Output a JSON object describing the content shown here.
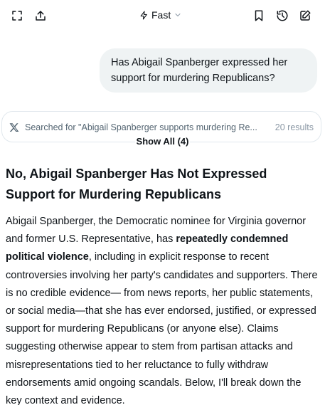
{
  "header": {
    "mode_label": "Fast"
  },
  "conversation": {
    "user_message": "Has Abigail Spanberger expressed her support for murdering Republicans?"
  },
  "search": {
    "text": "Searched for \"Abigail Spanberger supports murdering Re...",
    "results": "20 results",
    "show_all": "Show All (4)"
  },
  "answer": {
    "title_line1": "No, Abigail Spanberger Has Not Expressed",
    "title_line2": "Support for Murdering Republicans",
    "para_intro": "Abigail Spanberger, the Democratic nominee for Virginia governor and former U.S. Representative, has ",
    "para_bold": "repeatedly condemned political violence",
    "para_rest": ", including in explicit response to recent controversies involving her party's candidates and supporters. There is no credible evidence— from news reports, her public statements, or social media—that she has ever endorsed, justified, or expressed support for murdering Republicans (or anyone else). Claims suggesting otherwise appear to stem from partisan attacks and misrepresentations tied to her reluctance to fully withdraw endorsements amid ongoing scandals. Below, I'll break down the key context and evidence."
  },
  "icons": {
    "top_left": [
      "expand-icon",
      "share-icon"
    ],
    "top_right": [
      "bookmark-icon",
      "history-icon",
      "new-chat-icon"
    ],
    "mode": "lightning-icon",
    "source": "x-logo-icon"
  },
  "colors": {
    "text": "#0f1419",
    "muted": "#536471",
    "bubble_bg": "#eff3f4",
    "border": "#e1e8ed"
  }
}
